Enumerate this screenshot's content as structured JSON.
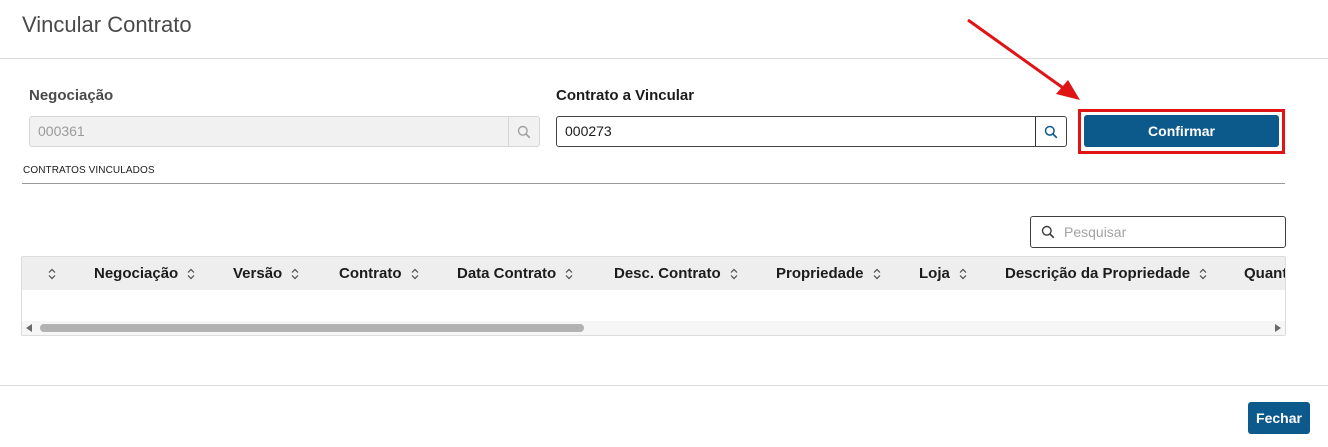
{
  "modal": {
    "title": "Vincular Contrato"
  },
  "form": {
    "negociacao": {
      "label": "Negociação",
      "value": "000361",
      "disabled": true
    },
    "contrato": {
      "label": "Contrato a Vincular",
      "value": "000273"
    },
    "confirm_label": "Confirmar"
  },
  "section": {
    "label": "CONTRATOS VINCULADOS"
  },
  "search": {
    "placeholder": "Pesquisar"
  },
  "table": {
    "columns": [
      "Negociação",
      "Versão",
      "Contrato",
      "Data Contrato",
      "Desc. Contrato",
      "Propriedade",
      "Loja",
      "Descrição da Propriedade",
      "Quant"
    ],
    "rows": []
  },
  "footer": {
    "close_label": "Fechar"
  },
  "colors": {
    "primary": "#0c5a8c",
    "annotation": "#e01414"
  }
}
